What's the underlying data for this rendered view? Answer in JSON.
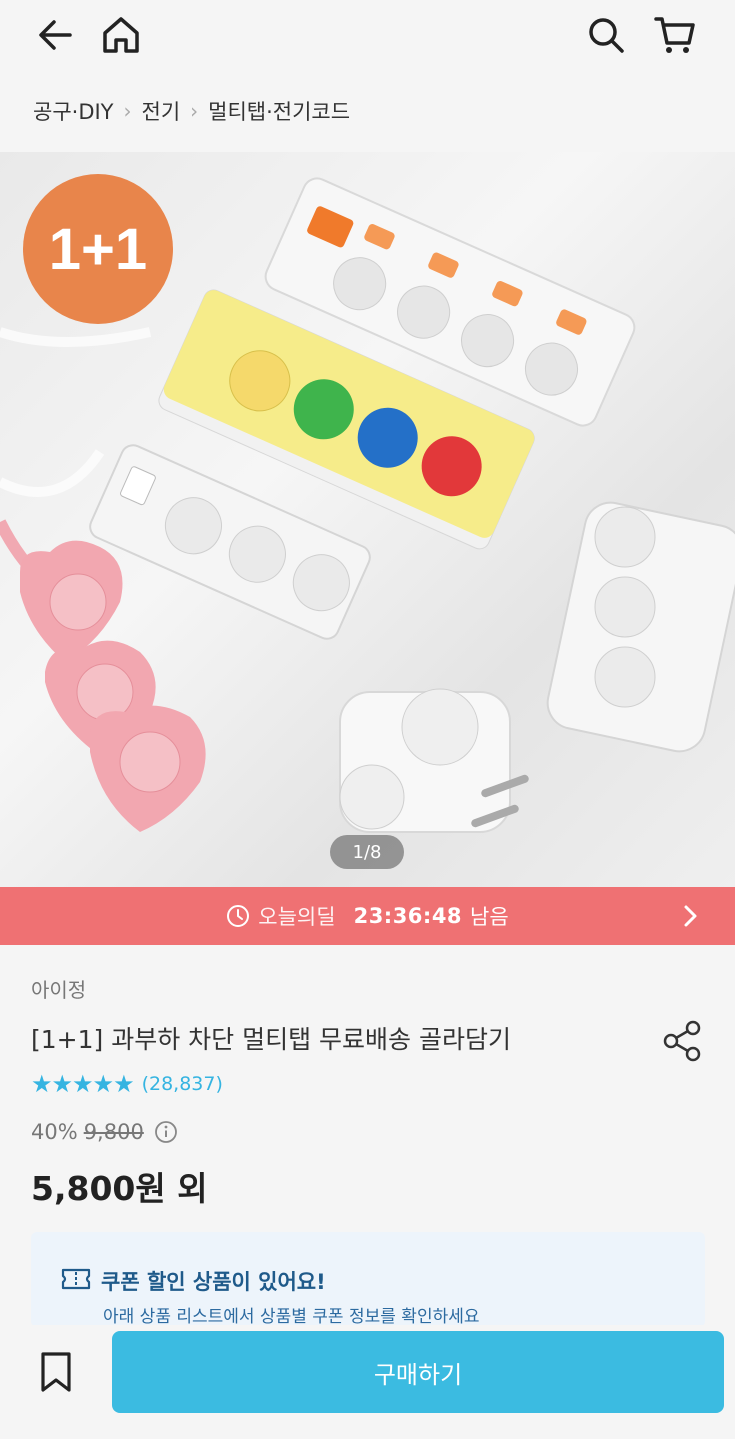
{
  "breadcrumb": [
    "공구·DIY",
    "전기",
    "멀티탭·전기코드"
  ],
  "hero": {
    "badge": "1+1",
    "pager": "1/8"
  },
  "deal": {
    "label": "오늘의딜",
    "time": "23:36:48",
    "suffix": "남음",
    "color": "#ef7173"
  },
  "product": {
    "brand": "아이정",
    "title": "[1+1] 과부하 차단 멀티탭 무료배송 골라담기",
    "stars": "★★★★★",
    "rating_count": "(28,837)",
    "discount": "40%",
    "original_price": "9,800",
    "price": "5,800원 외"
  },
  "coupon": {
    "title": "쿠폰 할인 상품이 있어요!",
    "subtitle": "아래 상품 리스트에서 상품별 쿠폰 정보를 확인하세요"
  },
  "bottom": {
    "buy_label": "구매하기"
  },
  "colors": {
    "accent": "#35b4e1",
    "buy": "#3bbbe1",
    "badge": "#e8854b"
  },
  "icons": [
    "back-arrow-icon",
    "home-icon",
    "search-icon",
    "cart-icon",
    "chevron-right-icon",
    "clock-icon",
    "share-icon",
    "info-icon",
    "coupon-icon",
    "bookmark-icon"
  ]
}
